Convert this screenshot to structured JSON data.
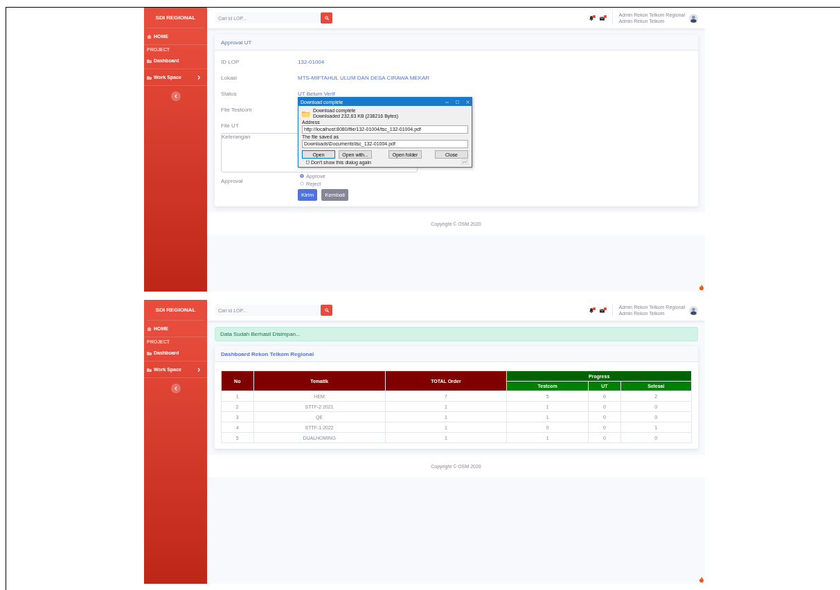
{
  "screens": [
    {
      "kind": "approval",
      "sidebar": {
        "brand": "SDI REGIONAL",
        "items": [
          {
            "kind": "link",
            "label": "HOME"
          },
          {
            "kind": "section",
            "label": "PROJECT"
          },
          {
            "kind": "link",
            "label": "Dashboard"
          },
          {
            "kind": "submenu",
            "label": "Work Space"
          }
        ]
      },
      "topbar": {
        "search": {
          "placeholder": "Cari id LOP..."
        },
        "user_name": "Admin Rekon Telkom Regional",
        "user_role": "Admin Rekon Telkom"
      },
      "card": {
        "title": "Approval UT",
        "fields": [
          {
            "kind": "text",
            "label": "ID LOP",
            "value": "132-01004"
          },
          {
            "kind": "text",
            "label": "Lokasi",
            "value": "MTS-MIFTAHUL ULUM DAN DESA CIRAWA MEKAR"
          },
          {
            "kind": "text",
            "label": "Status",
            "value": "UT Belum Verif"
          },
          {
            "kind": "text",
            "label": "File Testcom"
          },
          {
            "kind": "text",
            "label": "File UT"
          },
          {
            "kind": "textarea",
            "label": "Keterangan"
          },
          {
            "kind": "radio",
            "label": "Approval",
            "options": [
              {
                "label": "Approve",
                "selected": true
              },
              {
                "label": "Reject",
                "selected": false
              }
            ]
          }
        ],
        "buttons": [
          {
            "label": "Kirim",
            "kind": "primary"
          },
          {
            "label": "Kembali",
            "kind": "secondary"
          }
        ]
      },
      "dialog": {
        "title": "Download complete",
        "heading": "Download complete",
        "detail": "Downloaded 232,63 KB (238216 Bytes)",
        "fields": [
          {
            "label": "Address",
            "value": "http://localhost:8080/file/132-01004/tsc_132-01004.pdf"
          },
          {
            "label": "The file saved as",
            "value": "Downloads\\Documents\\tsc_132-01004.pdf"
          }
        ],
        "buttons": [
          {
            "label": "Open",
            "focused": true
          },
          {
            "label": "Open with...",
            "focused": false
          },
          {
            "label": "Open folder",
            "focused": false
          },
          {
            "label": "Close",
            "focused": false
          }
        ],
        "checkbox": {
          "label": "Don't show this dialog again",
          "checked": false
        }
      },
      "footer": "Copyright © OSM 2020"
    },
    {
      "kind": "dashboard",
      "sidebar": {
        "brand": "SDI REGIONAL",
        "items": [
          {
            "kind": "link",
            "label": "HOME"
          },
          {
            "kind": "section",
            "label": "PROJECT"
          },
          {
            "kind": "link",
            "label": "Dashboard"
          },
          {
            "kind": "submenu",
            "label": "Work Space"
          }
        ]
      },
      "topbar": {
        "search": {
          "placeholder": "Cari id LOP..."
        },
        "user_name": "Admin Rekon Telkom Regional",
        "user_role": "Admin Rekon Telkom"
      },
      "alert": "Data Sudah Berhasil Disimpan...",
      "card": {
        "title": "Dashboard Rekon Telkom Regional",
        "table": {
          "header_rows": [
            [
              {
                "kind": "plain",
                "label": "No",
                "rowspan": 2
              },
              {
                "kind": "plain",
                "label": "Tematik",
                "rowspan": 2
              },
              {
                "kind": "plain",
                "label": "TOTAL Order",
                "rowspan": 2
              },
              {
                "kind": "group",
                "label": "Progress",
                "colspan": 3
              }
            ],
            [
              {
                "kind": "sub",
                "label": "Testcom"
              },
              {
                "kind": "sub",
                "label": "UT"
              },
              {
                "kind": "sub",
                "label": "Selesai"
              }
            ]
          ],
          "rows": [
            [
              "1",
              "HEM",
              "7",
              "5",
              "0",
              "2"
            ],
            [
              "2",
              "STTF-2 2021",
              "1",
              "1",
              "0",
              "0"
            ],
            [
              "3",
              "QE",
              "1",
              "1",
              "0",
              "0"
            ],
            [
              "4",
              "STTF-1 2022",
              "1",
              "0",
              "0",
              "1"
            ],
            [
              "5",
              "DUALHOMING",
              "1",
              "1",
              "0",
              "0"
            ]
          ]
        }
      },
      "footer": "Copyright © OSM 2020"
    }
  ]
}
